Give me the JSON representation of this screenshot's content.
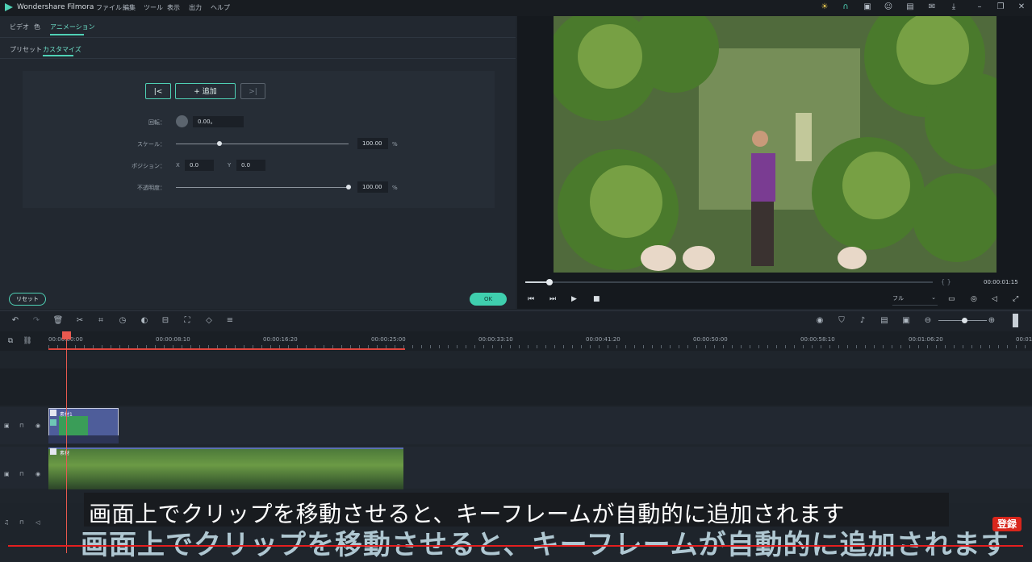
{
  "app": {
    "title": "Wondershare Filmora"
  },
  "menu": [
    "ファイル",
    "編集",
    "ツール",
    "表示",
    "出力",
    "ヘルプ"
  ],
  "tabs": [
    {
      "label": "ビデオ"
    },
    {
      "label": "色"
    },
    {
      "label": "アニメーション"
    }
  ],
  "subtabs": [
    {
      "label": "プリセット"
    },
    {
      "label": "カスタマイズ"
    }
  ],
  "keyframe": {
    "prev_label": "|<",
    "add_label": "+ 追加",
    "next_label": ">|"
  },
  "params": {
    "rotation": {
      "label": "回転：",
      "value": "0.00。"
    },
    "scale": {
      "label": "スケール：",
      "value": "100.00",
      "unit": "%",
      "level": 0.25
    },
    "position": {
      "label": "ポジション：",
      "x_label": "X",
      "x_value": "0.0",
      "y_label": "Y",
      "y_value": "0.0"
    },
    "opacity": {
      "label": "不透明度：",
      "value": "100.00",
      "unit": "%",
      "level": 1.0
    }
  },
  "buttons": {
    "reset": "リセット",
    "ok": "OK"
  },
  "preview": {
    "timecode": "00:00:01:15",
    "quality": "フル",
    "brackets": "{   }",
    "progress": 0.06
  },
  "ruler": [
    "00:00:00:00",
    "00:00:08:10",
    "00:00:16:20",
    "00:00:25:00",
    "00:00:33:10",
    "00:00:41:20",
    "00:00:50:00",
    "00:00:58:10",
    "00:01:06:20",
    "00:01"
  ],
  "clips": {
    "pip_title": "素材1",
    "main_title": "素材"
  },
  "subtitle": {
    "text": "画面上でクリップを移動させると、キーフレームが自動的に追加されます",
    "big_text": "画面上でクリップを移動させると、キーフレームが自動的に追加されます",
    "badge": "登録"
  }
}
